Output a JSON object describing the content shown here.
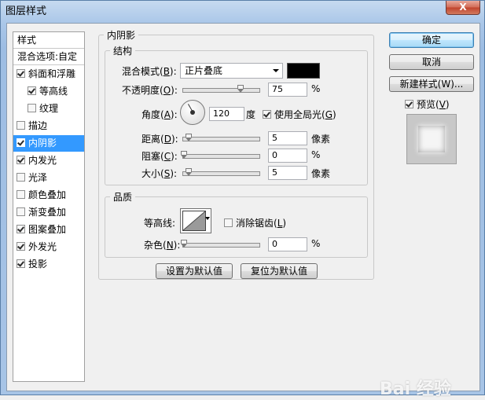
{
  "window": {
    "title": "图层样式",
    "close_glyph": "X"
  },
  "styles_panel": {
    "header": "样式",
    "blend_options": "混合选项:自定",
    "items": [
      {
        "label": "斜面和浮雕",
        "checked": true,
        "selected": false,
        "indent": false
      },
      {
        "label": "等高线",
        "checked": true,
        "selected": false,
        "indent": true
      },
      {
        "label": "纹理",
        "checked": false,
        "selected": false,
        "indent": true
      },
      {
        "label": "描边",
        "checked": false,
        "selected": false,
        "indent": false
      },
      {
        "label": "内阴影",
        "checked": true,
        "selected": true,
        "indent": false
      },
      {
        "label": "内发光",
        "checked": true,
        "selected": false,
        "indent": false
      },
      {
        "label": "光泽",
        "checked": false,
        "selected": false,
        "indent": false
      },
      {
        "label": "颜色叠加",
        "checked": false,
        "selected": false,
        "indent": false
      },
      {
        "label": "渐变叠加",
        "checked": false,
        "selected": false,
        "indent": false
      },
      {
        "label": "图案叠加",
        "checked": true,
        "selected": false,
        "indent": false
      },
      {
        "label": "外发光",
        "checked": true,
        "selected": false,
        "indent": false
      },
      {
        "label": "投影",
        "checked": true,
        "selected": false,
        "indent": false
      }
    ]
  },
  "inner_shadow": {
    "title": "内阴影",
    "structure": {
      "title": "结构",
      "blend_mode_label": "混合模式(",
      "blend_mode_key": "B",
      "blend_mode_suffix": "):",
      "blend_mode_value": "正片叠底",
      "color": "#000000",
      "opacity_label": "不透明度(",
      "opacity_key": "O",
      "opacity_suffix": "):",
      "opacity_value": "75",
      "opacity_unit": "%",
      "opacity_level": 0.75,
      "angle_label": "角度(",
      "angle_key": "A",
      "angle_suffix": "):",
      "angle_value": "120",
      "angle_unit": "度",
      "global_light_label": "使用全局光(",
      "global_light_key": "G",
      "global_light_suffix": ")",
      "global_light_checked": true,
      "distance_label": "距离(",
      "distance_key": "D",
      "distance_suffix": "):",
      "distance_value": "5",
      "distance_unit": "像素",
      "choke_label": "阻塞(",
      "choke_key": "C",
      "choke_suffix": "):",
      "choke_value": "0",
      "choke_unit": "%",
      "size_label": "大小(",
      "size_key": "S",
      "size_suffix": "):",
      "size_value": "5",
      "size_unit": "像素"
    },
    "quality": {
      "title": "品质",
      "contour_label": "等高线:",
      "antialias_label": "消除锯齿(",
      "antialias_key": "L",
      "antialias_suffix": ")",
      "antialias_checked": false,
      "noise_label": "杂色(",
      "noise_key": "N",
      "noise_suffix": "):",
      "noise_value": "0",
      "noise_unit": "%"
    },
    "make_default": "设置为默认值",
    "reset_default": "复位为默认值"
  },
  "buttons": {
    "ok": "确定",
    "cancel": "取消",
    "new_style": "新建样式(W)...",
    "preview_label": "预览(",
    "preview_key": "V",
    "preview_suffix": ")",
    "preview_checked": true
  },
  "watermark": "Bai 经验"
}
